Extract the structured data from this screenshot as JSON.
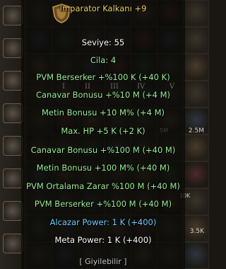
{
  "background": {
    "slot_labels": [
      "I",
      "II",
      "III",
      "IV",
      "V"
    ],
    "corner_tags": [
      "2.5M",
      "5M",
      "3.5K",
      "10K"
    ]
  },
  "tooltip": {
    "title": "İmparator Kalkanı +9",
    "level": "Seviye: 55",
    "upgrade": "Cila: 4",
    "attributes": [
      "PVM Berserker +%100 K (+40 K)",
      "Canavar Bonusu +%10 M (+4 M)",
      "Metin Bonusu +10 M% (+4 M)",
      "Max. HP +5 K (+2 K)",
      "Canavar Bonusu +%100 M (+40 M)",
      "Metin Bonusu +100 M% (+40 M)",
      "PVM Ortalama Zarar %100 M (+40 M)",
      "PVM Berserker +%100 M (+40 M)"
    ],
    "alcazar_power": "Alcazar Power: 1 K (+400)",
    "meta_power": "Meta Power: 1 K (+400)",
    "wearable": "[ Giyilebilir ]"
  },
  "colors": {
    "title": "#f0d068",
    "attribute": "#9cf098",
    "alcazar": "#70d0ff",
    "meta": "#ffffff"
  }
}
